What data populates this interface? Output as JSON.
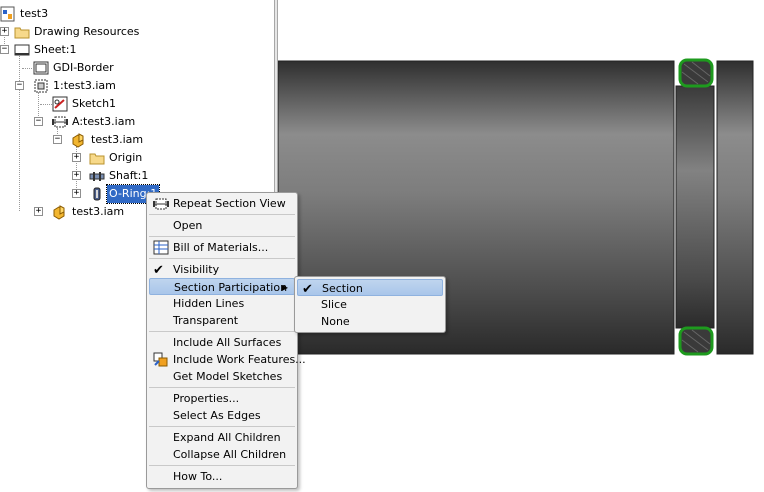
{
  "tree": {
    "items": [
      {
        "label": "test3",
        "icon": "drawing-icon"
      },
      {
        "label": "Drawing Resources",
        "icon": "folder-icon"
      },
      {
        "label": "Sheet:1",
        "icon": "sheet-icon"
      },
      {
        "label": "GDI-Border",
        "icon": "border-icon"
      },
      {
        "label": "1:test3.iam",
        "icon": "view-icon"
      },
      {
        "label": "Sketch1",
        "icon": "sketch-icon"
      },
      {
        "label": "A:test3.iam",
        "icon": "section-view-icon"
      },
      {
        "label": "test3.iam",
        "icon": "assembly-icon"
      },
      {
        "label": "Origin",
        "icon": "folder-icon"
      },
      {
        "label": "Shaft:1",
        "icon": "part-icon"
      },
      {
        "label": "O-Ring:1",
        "icon": "part-icon",
        "selected": true
      },
      {
        "label": "test3.iam",
        "icon": "assembly-icon"
      }
    ]
  },
  "context_menu": {
    "items": [
      {
        "label": "Repeat Section View",
        "icon": "repeat-section-icon"
      },
      {
        "label": "Open"
      },
      {
        "label": "Bill of Materials...",
        "icon": "bom-icon"
      },
      {
        "label": "Visibility",
        "checked": true
      },
      {
        "label": "Section Participation",
        "submenu": true,
        "highlighted": true
      },
      {
        "label": "Hidden Lines"
      },
      {
        "label": "Transparent"
      },
      {
        "label": "Include All Surfaces"
      },
      {
        "label": "Include Work Features...",
        "icon": "work-features-icon"
      },
      {
        "label": "Get Model Sketches"
      },
      {
        "label": "Properties..."
      },
      {
        "label": "Select As Edges"
      },
      {
        "label": "Expand All Children"
      },
      {
        "label": "Collapse All Children"
      },
      {
        "label": "How To..."
      }
    ]
  },
  "submenu": {
    "items": [
      {
        "label": "Section",
        "checked": true,
        "highlighted": true
      },
      {
        "label": "Slice"
      },
      {
        "label": "None"
      }
    ]
  },
  "colors": {
    "selection": "#316ac5",
    "oring_green": "#1e9a1e",
    "shaft_light": "#8c8c8c",
    "shaft_dark": "#2f2f2f",
    "menu_bg": "#f2f2f2",
    "menu_highlight": "#b4cdee"
  }
}
